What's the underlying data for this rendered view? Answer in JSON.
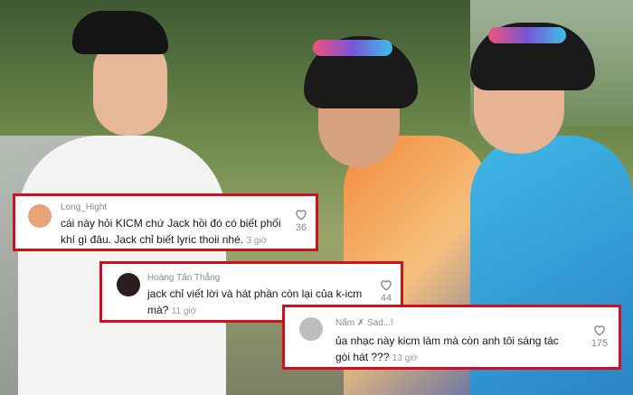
{
  "comments": [
    {
      "username": "Long_Hight",
      "text_line1": "cái này hỏi KICM chứ Jack hồi đó có biết phối",
      "text_line2": "khí gì đâu. Jack chỉ biết lyric thoii nhé.",
      "time": "3 giờ",
      "likes": "36"
    },
    {
      "username": "Hoàng Tấn Thắng",
      "text_line1": "jack chỉ viết lời và hát phần còn lại của k-icm",
      "text_line2": "mà?",
      "time": "11 giờ",
      "likes": "44"
    },
    {
      "username": "Nấm ✗ Sad...!",
      "text_line1": "ủa nhạc này kicm làm mà còn anh tôi sáng tác",
      "text_line2": "gòi hát ???",
      "time": "13 giờ",
      "likes": "175"
    }
  ],
  "colors": {
    "frame_border": "#d0101c",
    "avatar_1": "#e9a37a",
    "avatar_2": "#2b1d1d",
    "avatar_3": "#bdbdbd"
  },
  "icons": {
    "like": "heart-outline-icon"
  }
}
